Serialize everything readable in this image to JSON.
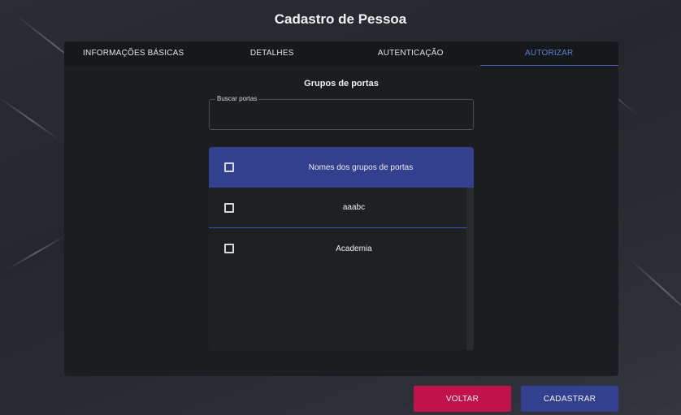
{
  "page": {
    "title": "Cadastro de Pessoa"
  },
  "tabs": [
    {
      "label": "INFORMAÇÕES BÁSICAS",
      "active": false
    },
    {
      "label": "DETALHES",
      "active": false
    },
    {
      "label": "AUTENTICAÇÃO",
      "active": false
    },
    {
      "label": "AUTORIZAR",
      "active": true
    }
  ],
  "authorize": {
    "section_title": "Grupos de portas",
    "search": {
      "label": "Buscar portas",
      "value": "",
      "placeholder": ""
    },
    "table": {
      "header": "Nomes dos grupos de portas",
      "rows": [
        {
          "name": "aaabc",
          "checked": false
        },
        {
          "name": "Academia",
          "checked": false
        }
      ]
    }
  },
  "actions": {
    "back_label": "VOLTAR",
    "submit_label": "CADASTRAR"
  },
  "colors": {
    "accent": "#333f8f",
    "active_tab": "#5f7fd8",
    "back_button": "#c2124b",
    "panel": "#1c1d21"
  },
  "icons": {
    "checkbox": "checkbox-unchecked-icon"
  }
}
